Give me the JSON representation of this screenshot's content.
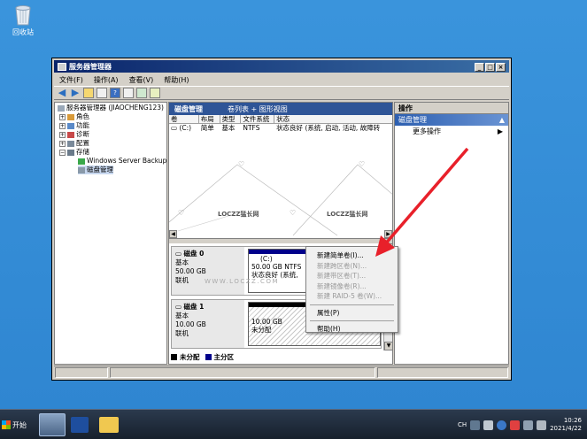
{
  "desktop": {
    "recycle_label": "回收站"
  },
  "window": {
    "title": "服务器管理器",
    "menu": [
      "文件(F)",
      "操作(A)",
      "查看(V)",
      "帮助(H)"
    ]
  },
  "tree": {
    "root": "服务器管理器 (JIAOCHENG123)",
    "roles": "角色",
    "features": "功能",
    "diagnostics": "诊断",
    "config": "配置",
    "storage": "存储",
    "wsb": "Windows Server Backup",
    "disk_mgmt": "磁盘管理"
  },
  "center": {
    "title": "磁盘管理",
    "subtitle": "卷列表 + 图形视图",
    "columns": [
      "卷",
      "布局",
      "类型",
      "文件系统",
      "状态"
    ],
    "volume_row": [
      "(C:)",
      "简单",
      "基本",
      "NTFS",
      "状态良好 (系统, 启动, 活动, 故障转"
    ],
    "watermark_left": "LOCZZ猛长网",
    "watermark_right": "LOCZZ猛长网",
    "watermark_url": "WWW.LOCZZ.COM",
    "disk0": {
      "name": "磁盘 0",
      "type": "基本",
      "size": "50.00 GB",
      "status": "联机",
      "part_label": "(C:)",
      "part_size": "50.00 GB NTFS",
      "part_status": "状态良好 (系统,"
    },
    "disk1": {
      "name": "磁盘 1",
      "type": "基本",
      "size": "10.00 GB",
      "status": "联机",
      "part_size": "10.00 GB",
      "part_status": "未分配"
    },
    "legend_unalloc": "未分配",
    "legend_primary": "主分区"
  },
  "actions": {
    "title": "操作",
    "section": "磁盘管理",
    "more": "更多操作"
  },
  "context_menu": {
    "items": [
      {
        "label": "新建简单卷(I)...",
        "enabled": true
      },
      {
        "label": "新建跨区卷(N)...",
        "enabled": false
      },
      {
        "label": "新建带区卷(T)...",
        "enabled": false
      },
      {
        "label": "新建镜像卷(R)...",
        "enabled": false
      },
      {
        "label": "新建 RAID-5 卷(W)...",
        "enabled": false
      },
      {
        "label": "属性(P)",
        "enabled": true
      },
      {
        "label": "帮助(H)",
        "enabled": true
      }
    ]
  },
  "taskbar": {
    "start_label": "开始",
    "lang": "CH",
    "time": "10:26",
    "date": "2021/4/22"
  },
  "colors": {
    "accent": "#2f5597",
    "primary_partition": "#00008b",
    "unallocated": "#000000"
  }
}
